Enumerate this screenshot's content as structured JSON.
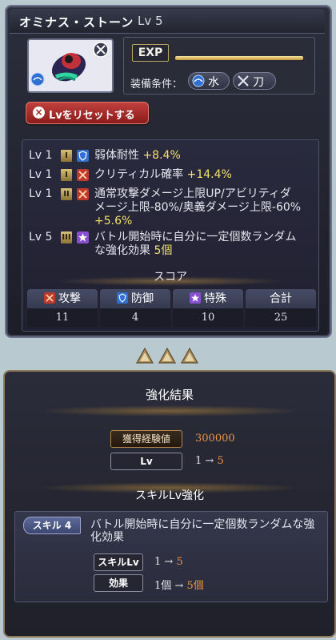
{
  "title": "オミナス・ストーン",
  "title_lv": "Lv 5",
  "exp_label": "EXP",
  "req_label": "装備条件：",
  "req_items": [
    {
      "icon": "water-element-icon",
      "label": "水"
    },
    {
      "icon": "sword-icon",
      "label": "刀"
    }
  ],
  "reset_button": "Lvをリセットする",
  "effects": [
    {
      "lv": "Lv 1",
      "rank": "I",
      "category": "defense",
      "text": "弱体耐性",
      "value": "+8.4%"
    },
    {
      "lv": "Lv 1",
      "rank": "I",
      "category": "attack",
      "text": "クリティカル確率",
      "value": "+14.4%"
    },
    {
      "lv": "Lv 1",
      "rank": "II",
      "category": "attack",
      "text_lines": [
        "通常攻撃ダメージ上限UP/アビリティダ",
        "メージ上限-80%/奥義ダメージ上限-60%"
      ],
      "value": "+5.6%"
    },
    {
      "lv": "Lv 5",
      "rank": "III",
      "category": "special",
      "text_lines": [
        "バトル開始時に自分に一定個数ランダム",
        "な強化効果"
      ],
      "value": "5個"
    }
  ],
  "score": {
    "title": "スコア",
    "columns": [
      {
        "label": "攻撃",
        "icon": "attack-icon",
        "value": "11"
      },
      {
        "label": "防御",
        "icon": "shield-icon",
        "value": "4"
      },
      {
        "label": "特殊",
        "icon": "star-icon",
        "value": "10"
      },
      {
        "label": "合計",
        "icon": "",
        "value": "25"
      }
    ]
  },
  "result": {
    "title": "強化結果",
    "exp_label": "獲得経験値",
    "exp_value": "300000",
    "lv_label": "Lv",
    "lv_from": "1",
    "arrow": "→",
    "lv_to": "5"
  },
  "skill": {
    "title": "スキルLv強化",
    "badge": "スキル 4",
    "desc": "バトル開始時に自分に一定個数ランダムな強化効果",
    "lv_label": "スキルLv",
    "lv_from": "1",
    "lv_to": "5",
    "effect_label": "効果",
    "effect_from": "1個",
    "effect_to": "5個"
  },
  "colors": {
    "attack": "#c0392b",
    "defense": "#2f6fd0",
    "special": "#8a4fd0",
    "value_yellow": "#f3e06a",
    "value_orange": "#f1923e"
  }
}
